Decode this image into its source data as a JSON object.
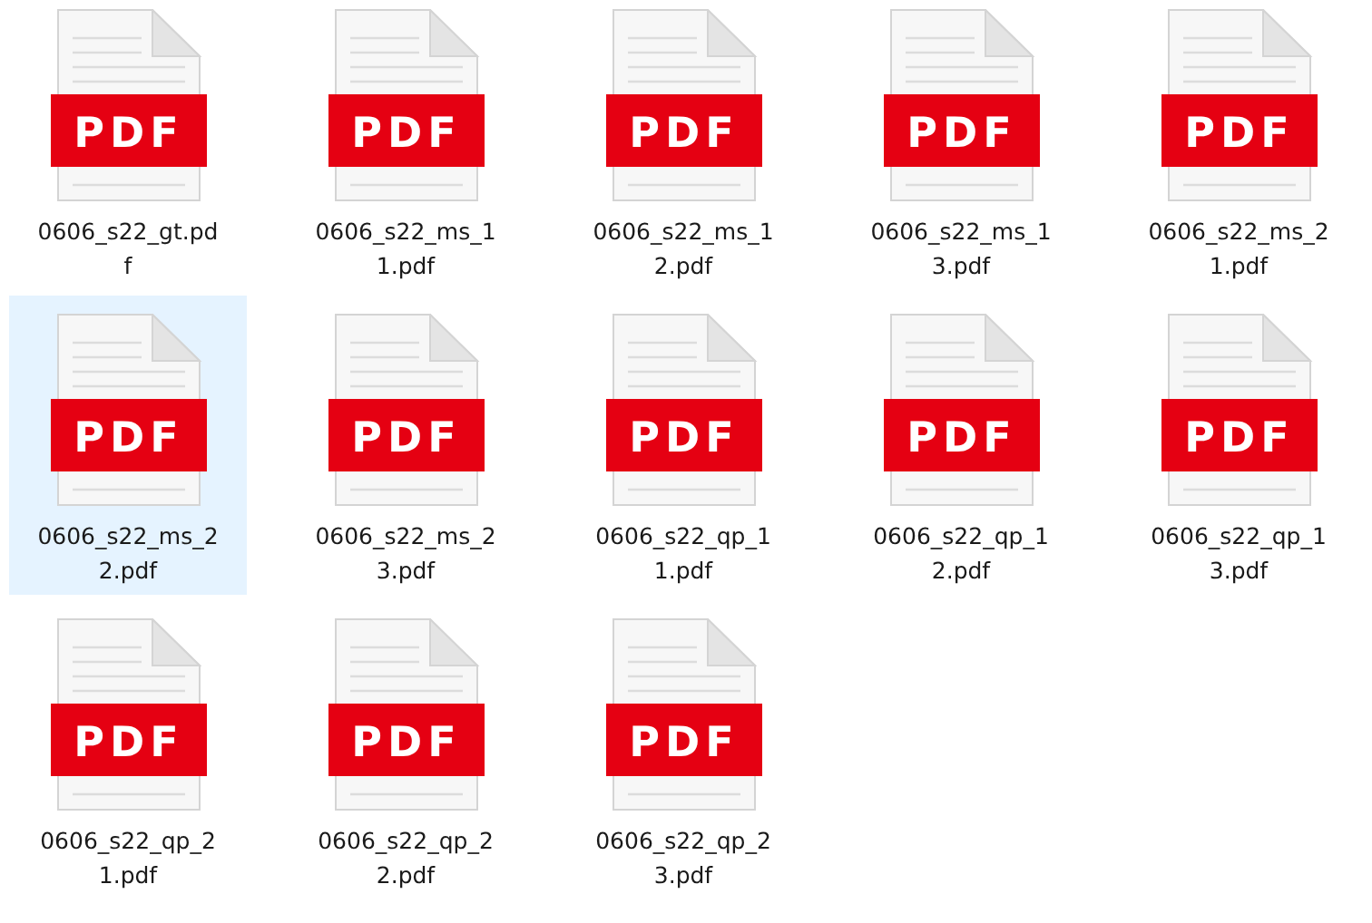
{
  "files": [
    {
      "icon_label": "PDF",
      "name_lines": [
        "0606_s22_gt.pd",
        "f"
      ],
      "selected": false
    },
    {
      "icon_label": "PDF",
      "name_lines": [
        "0606_s22_ms_1",
        "1.pdf"
      ],
      "selected": false
    },
    {
      "icon_label": "PDF",
      "name_lines": [
        "0606_s22_ms_1",
        "2.pdf"
      ],
      "selected": false
    },
    {
      "icon_label": "PDF",
      "name_lines": [
        "0606_s22_ms_1",
        "3.pdf"
      ],
      "selected": false
    },
    {
      "icon_label": "PDF",
      "name_lines": [
        "0606_s22_ms_2",
        "1.pdf"
      ],
      "selected": false
    },
    {
      "icon_label": "PDF",
      "name_lines": [
        "0606_s22_ms_2",
        "2.pdf"
      ],
      "selected": true
    },
    {
      "icon_label": "PDF",
      "name_lines": [
        "0606_s22_ms_2",
        "3.pdf"
      ],
      "selected": false
    },
    {
      "icon_label": "PDF",
      "name_lines": [
        "0606_s22_qp_1",
        "1.pdf"
      ],
      "selected": false
    },
    {
      "icon_label": "PDF",
      "name_lines": [
        "0606_s22_qp_1",
        "2.pdf"
      ],
      "selected": false
    },
    {
      "icon_label": "PDF",
      "name_lines": [
        "0606_s22_qp_1",
        "3.pdf"
      ],
      "selected": false
    },
    {
      "icon_label": "PDF",
      "name_lines": [
        "0606_s22_qp_2",
        "1.pdf"
      ],
      "selected": false
    },
    {
      "icon_label": "PDF",
      "name_lines": [
        "0606_s22_qp_2",
        "2.pdf"
      ],
      "selected": false
    },
    {
      "icon_label": "PDF",
      "name_lines": [
        "0606_s22_qp_2",
        "3.pdf"
      ],
      "selected": false
    }
  ]
}
